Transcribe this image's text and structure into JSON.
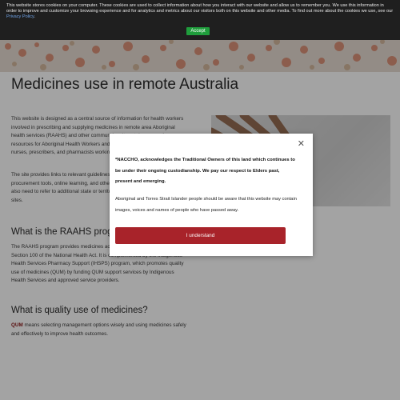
{
  "cookie_banner": {
    "text": "This website stores cookies on your computer. These cookies are used to collect information about how you interact with our website and allow us to remember you. We use this information in order to improve and customize your browsing experience and for analytics and metrics about our visitors both on this website and other media. To find out more about the cookies we use, see our",
    "policy_link": "Privacy Policy",
    "end": ".",
    "accept_label": "Accept"
  },
  "main": {
    "title": "Medicines use in remote Australia",
    "intro": "This website is designed as a central source of information for health workers involved in prescribing and supplying medicines in remote area Aboriginal health services (RAAHS) and other communities. It contains supporting resources for Aboriginal Health Workers and Aboriginal Health Practitioners, nurses, prescribers, and pharmacists working in these areas.",
    "links_para": "The site provides links to relevant guidelines, policies, procedures, procurement tools, online learning, and other resources. Health workers may also need to refer to additional state or territory guidelines in their individual sites.",
    "raahs_heading": "What is the RAAHS program?",
    "raahs_para": "The RAAHS program provides medicines access in remote areas under the Section 100 of the National Health Act. It is complemented by the Indigenous Health Services Pharmacy Support (IHSPS) program, which promotes quality use of medicines (QUM) by funding QUM support services by Indigenous Health Services and approved service providers.",
    "qum_heading": "What is quality use of medicines?",
    "qum_term": "QUM",
    "qum_text": " means selecting management options wisely and using medicines safely and effectively to improve health outcomes."
  },
  "modal": {
    "close_glyph": "✕",
    "acknowledgement": "*NACCHO, acknowledges the Traditional Owners of this land which continues to be under their ongoing custodianship. We pay our respect to Elders past, present and emerging.",
    "warning": "Aboriginal and Torres Strait Islander people should be aware that this website may contain images, voices and names of people who have passed away.",
    "button_label": "I understand"
  },
  "colors": {
    "cookie_bg": "#1f1f1f",
    "accept_green": "#1f9d3c",
    "modal_button": "#a8232a",
    "qum_accent": "#8b1a1a"
  }
}
